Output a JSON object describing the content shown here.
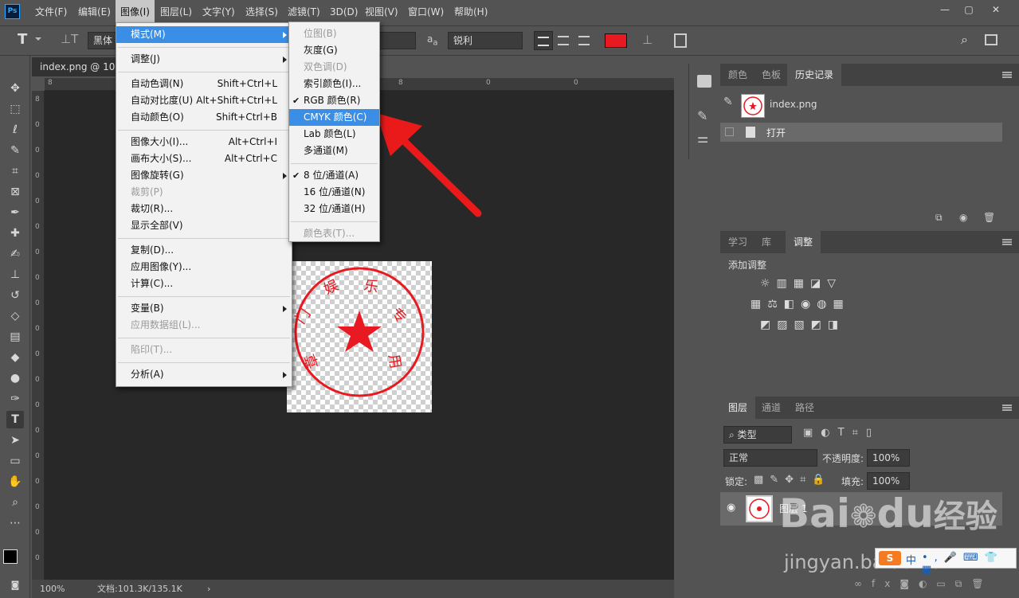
{
  "app": {
    "logo": "Ps",
    "menus": [
      "文件(F)",
      "编辑(E)",
      "图像(I)",
      "图层(L)",
      "文字(Y)",
      "选择(S)",
      "滤镜(T)",
      "3D(D)",
      "视图(V)",
      "窗口(W)",
      "帮助(H)"
    ],
    "window_buttons": [
      "—",
      "▢",
      "✕"
    ]
  },
  "options_bar": {
    "font_family": "黑体",
    "aa_label": "a",
    "aa_sub": "a",
    "aa_mode": "锐利",
    "text_color": "#e81921"
  },
  "document": {
    "tab_title": "index.png @ 100",
    "zoom": "100%",
    "doc_info": "文档:101.3K/135.1K",
    "ruler_h": [
      "8",
      "0",
      "0",
      "2",
      "8",
      "0",
      "0"
    ],
    "ruler_v": [
      "8",
      "0",
      "0",
      "0",
      "0",
      "0",
      "0",
      "0",
      "0",
      "0",
      "0",
      "0",
      "0",
      "0",
      "0",
      "0",
      "0",
      "0",
      "0"
    ]
  },
  "stamp": {
    "chars": [
      "门",
      "娱",
      "乐",
      "专",
      "用",
      "章"
    ],
    "color": "#e81921"
  },
  "image_menu": {
    "items": [
      {
        "label": "模式(M)",
        "shortcut": "",
        "submenu": true,
        "highlight": true
      },
      {
        "sep": true
      },
      {
        "label": "调整(J)",
        "shortcut": "",
        "submenu": true
      },
      {
        "sep": true
      },
      {
        "label": "自动色调(N)",
        "shortcut": "Shift+Ctrl+L"
      },
      {
        "label": "自动对比度(U)",
        "shortcut": "Alt+Shift+Ctrl+L"
      },
      {
        "label": "自动颜色(O)",
        "shortcut": "Shift+Ctrl+B"
      },
      {
        "sep": true
      },
      {
        "label": "图像大小(I)...",
        "shortcut": "Alt+Ctrl+I"
      },
      {
        "label": "画布大小(S)...",
        "shortcut": "Alt+Ctrl+C"
      },
      {
        "label": "图像旋转(G)",
        "shortcut": "",
        "submenu": true
      },
      {
        "label": "裁剪(P)",
        "shortcut": "",
        "disabled": true
      },
      {
        "label": "裁切(R)...",
        "shortcut": ""
      },
      {
        "label": "显示全部(V)",
        "shortcut": ""
      },
      {
        "sep": true
      },
      {
        "label": "复制(D)...",
        "shortcut": ""
      },
      {
        "label": "应用图像(Y)...",
        "shortcut": ""
      },
      {
        "label": "计算(C)...",
        "shortcut": ""
      },
      {
        "sep": true
      },
      {
        "label": "变量(B)",
        "shortcut": "",
        "submenu": true
      },
      {
        "label": "应用数据组(L)...",
        "shortcut": "",
        "disabled": true
      },
      {
        "sep": true
      },
      {
        "label": "陷印(T)...",
        "shortcut": "",
        "disabled": true
      },
      {
        "sep": true
      },
      {
        "label": "分析(A)",
        "shortcut": "",
        "submenu": true
      }
    ]
  },
  "mode_submenu": {
    "items": [
      {
        "label": "位图(B)",
        "disabled": true
      },
      {
        "label": "灰度(G)"
      },
      {
        "label": "双色调(D)",
        "disabled": true
      },
      {
        "label": "索引颜色(I)..."
      },
      {
        "label": "RGB 颜色(R)",
        "checked": true
      },
      {
        "label": "CMYK 颜色(C)",
        "highlight": true
      },
      {
        "label": "Lab 颜色(L)"
      },
      {
        "label": "多通道(M)"
      },
      {
        "sep": true
      },
      {
        "label": "8 位/通道(A)",
        "checked": true
      },
      {
        "label": "16 位/通道(N)"
      },
      {
        "label": "32 位/通道(H)"
      },
      {
        "sep": true
      },
      {
        "label": "颜色表(T)...",
        "disabled": true
      }
    ]
  },
  "panels": {
    "history": {
      "tabs": [
        "颜色",
        "色板",
        "历史记录"
      ],
      "active": 2,
      "snapshot_name": "index.png",
      "steps": [
        "打开"
      ]
    },
    "adjustments": {
      "tabs": [
        "学习",
        "库",
        "调整"
      ],
      "active": 2,
      "heading": "添加调整"
    },
    "layers": {
      "tabs": [
        "图层",
        "通道",
        "路径"
      ],
      "active": 0,
      "filter_kind": "类型",
      "blend_mode": "正常",
      "opacity_label": "不透明度:",
      "opacity": "100%",
      "lock_label": "锁定:",
      "fill_label": "填充:",
      "fill": "100%",
      "layer_name": "图层 1"
    }
  },
  "watermark": {
    "brand": "Bai",
    "brand2": "du",
    "brand_cn": "经验",
    "url": "jingyan.baidu.com",
    "ime_text": "中"
  }
}
